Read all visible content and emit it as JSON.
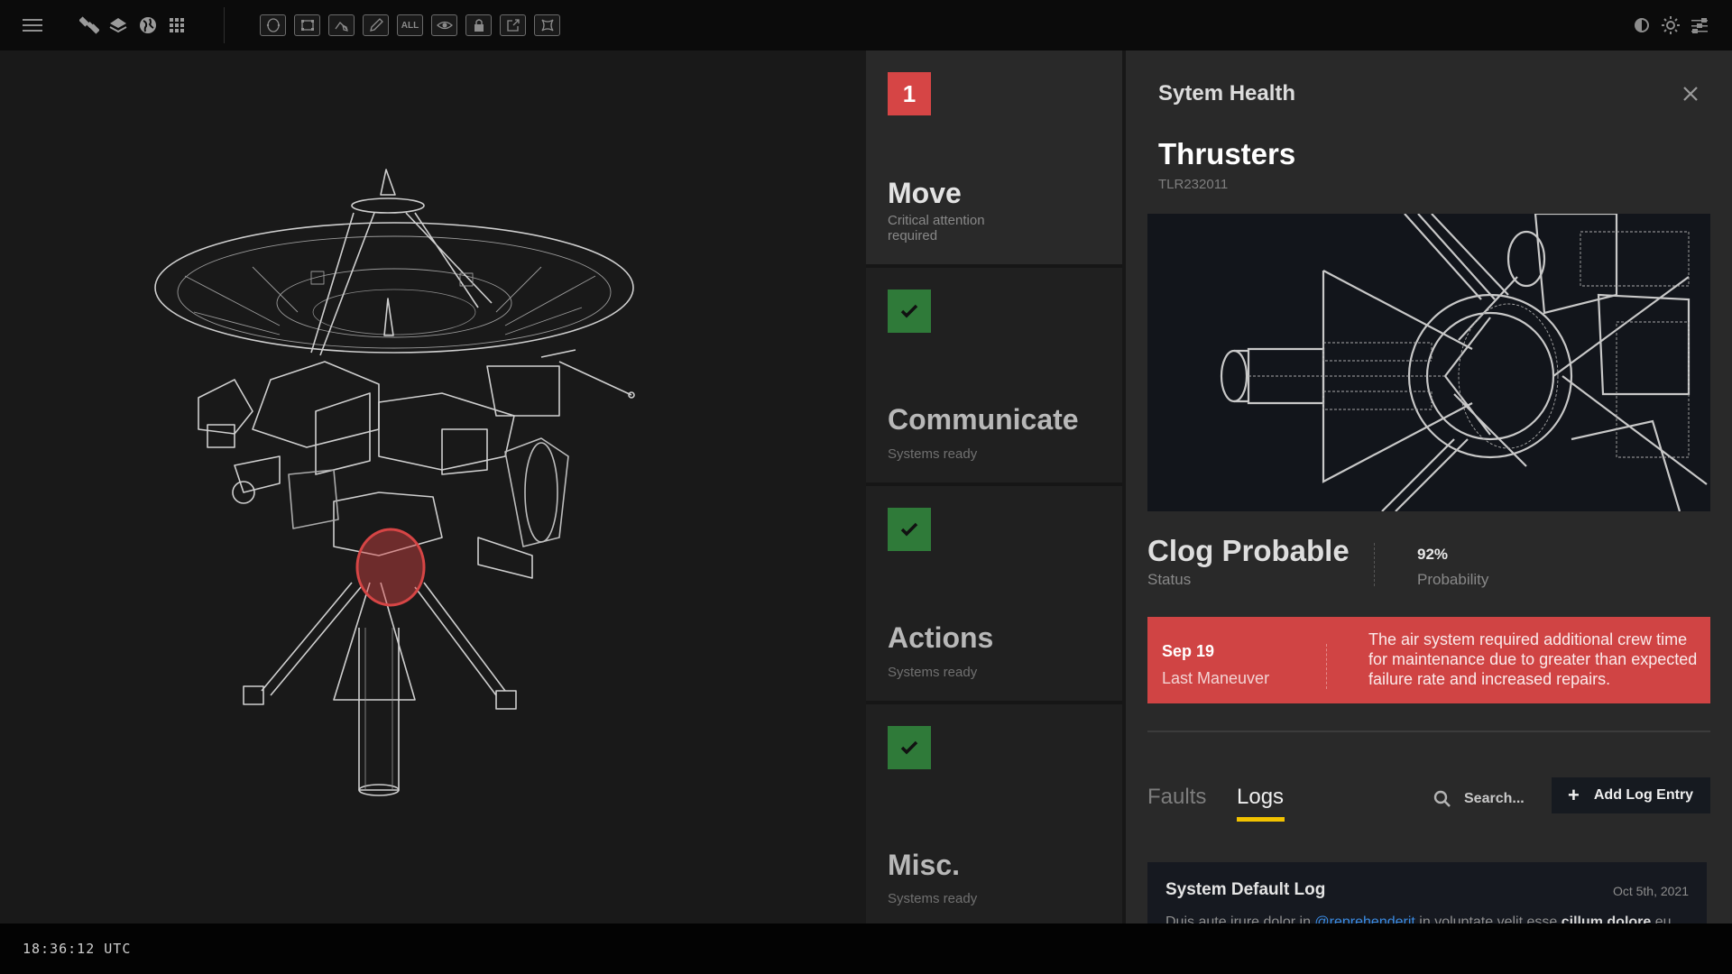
{
  "toolbar": {
    "left_icons": [
      "menu-icon",
      "satellite-icon",
      "layers-icon",
      "globe-icon",
      "apps-grid-icon"
    ],
    "tools": [
      {
        "name": "ellipse-select-tool",
        "label": ""
      },
      {
        "name": "rect-select-tool",
        "label": ""
      },
      {
        "name": "pen-path-tool",
        "label": ""
      },
      {
        "name": "pencil-tool",
        "label": ""
      },
      {
        "name": "select-all-tool",
        "label": "ALL"
      },
      {
        "name": "visibility-tool",
        "label": ""
      },
      {
        "name": "lock-tool",
        "label": ""
      },
      {
        "name": "external-link-tool",
        "label": ""
      },
      {
        "name": "fit-bounds-tool",
        "label": ""
      }
    ],
    "right_icons": [
      "contrast-icon",
      "brightness-icon",
      "sliders-icon"
    ]
  },
  "viewport": {
    "model": "Spacecraft wireframe",
    "highlight_color": "#d64545"
  },
  "footer": {
    "clock": "18:36:12 UTC"
  },
  "subsystems": [
    {
      "badge": "1",
      "status": "critical",
      "title": "Move",
      "subtitle": "Critical attention required",
      "color": "#d64545"
    },
    {
      "badge": "check",
      "status": "ok",
      "title": "Communicate",
      "subtitle": "Systems ready",
      "color": "#2f7a39"
    },
    {
      "badge": "check",
      "status": "ok",
      "title": "Actions",
      "subtitle": "Systems ready",
      "color": "#2f7a39"
    },
    {
      "badge": "check",
      "status": "ok",
      "title": "Misc.",
      "subtitle": "Systems ready",
      "color": "#2f7a39"
    }
  ],
  "panel": {
    "header": "Sytem Health",
    "component": "Thrusters",
    "component_id": "TLR232011",
    "status_value": "Clog Probable",
    "status_label": "Status",
    "probability_value": "92%",
    "probability_label": "Probability",
    "alert": {
      "date": "Sep 19",
      "date_label": "Last Maneuver",
      "message": "The air system required additional crew time for maintenance due to greater than expected failure rate and increased repairs.",
      "color": "#d04444"
    },
    "tabs": [
      {
        "label": "Faults",
        "active": false
      },
      {
        "label": "Logs",
        "active": true
      }
    ],
    "tab_accent": "#f2c200",
    "search_placeholder": "Search...",
    "add_button": "Add Log Entry",
    "log": {
      "title": "System Default Log",
      "date": "Oct 5th, 2021",
      "body_start": "Duis aute irure dolor in ",
      "mention": "@reprehenderit",
      "body_mid": " in voluptate velit esse ",
      "body_bold": "cillum dolore",
      "body_end": " eu"
    }
  }
}
